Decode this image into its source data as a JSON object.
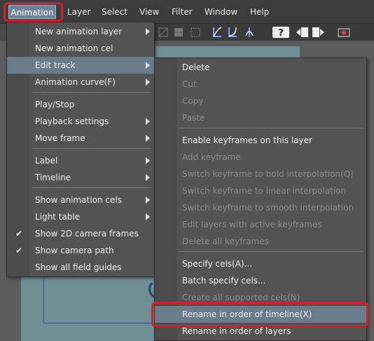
{
  "menubar": {
    "items": [
      "Animation",
      "Layer",
      "Select",
      "View",
      "Filter",
      "Window",
      "Help"
    ]
  },
  "animation_menu": {
    "items": [
      {
        "label": "New animation layer",
        "submenu": true
      },
      {
        "label": "New animation cel"
      },
      {
        "label": "Edit track",
        "submenu": true,
        "highlighted": true
      },
      {
        "label": "Animation curve(F)",
        "submenu": true
      },
      {
        "label": "Play/Stop"
      },
      {
        "label": "Playback settings",
        "submenu": true
      },
      {
        "label": "Move frame",
        "submenu": true
      },
      {
        "label": "Label",
        "submenu": true
      },
      {
        "label": "Timeline",
        "submenu": true
      },
      {
        "label": "Show animation cels",
        "submenu": true
      },
      {
        "label": "Light table",
        "submenu": true
      },
      {
        "label": "Show 2D camera frames",
        "checked": true
      },
      {
        "label": "Show camera path",
        "checked": true
      },
      {
        "label": "Show all field guides"
      }
    ]
  },
  "edit_track_menu": {
    "items": [
      {
        "label": "Delete"
      },
      {
        "label": "Cut",
        "disabled": true
      },
      {
        "label": "Copy",
        "disabled": true
      },
      {
        "label": "Paste",
        "disabled": true
      },
      {
        "label": "Enable keyframes on this layer"
      },
      {
        "label": "Add keyframe",
        "disabled": true
      },
      {
        "label": "Switch keyframe to hold interpolation(Q)",
        "disabled": true
      },
      {
        "label": "Switch keyframe to linear interpolation",
        "disabled": true
      },
      {
        "label": "Switch keyframe to smooth interpolation",
        "disabled": true
      },
      {
        "label": "Edit layers with active keyframes",
        "disabled": true
      },
      {
        "label": "Delete all keyframes",
        "disabled": true
      },
      {
        "label": "Specify cels(A)..."
      },
      {
        "label": "Batch specify cels..."
      },
      {
        "label": "Create all supported cels(N)",
        "disabled": true
      },
      {
        "label": "Rename in order of timeline(X)",
        "highlighted": true
      },
      {
        "label": "Rename in order of layers"
      }
    ]
  },
  "colors": {
    "highlight_outline": "#d4202a",
    "menu_bg": "#535353",
    "menu_highlight": "#6a7c8c",
    "canvas_teal": "#6f8f94"
  },
  "icons": [
    "rotate-canvas-icon",
    "grid-icon",
    "frame-icon",
    "curve-tool-1-icon",
    "curve-tool-2-icon",
    "curve-tool-3-icon",
    "help-icon",
    "import-icon",
    "export-icon",
    "record-icon"
  ]
}
